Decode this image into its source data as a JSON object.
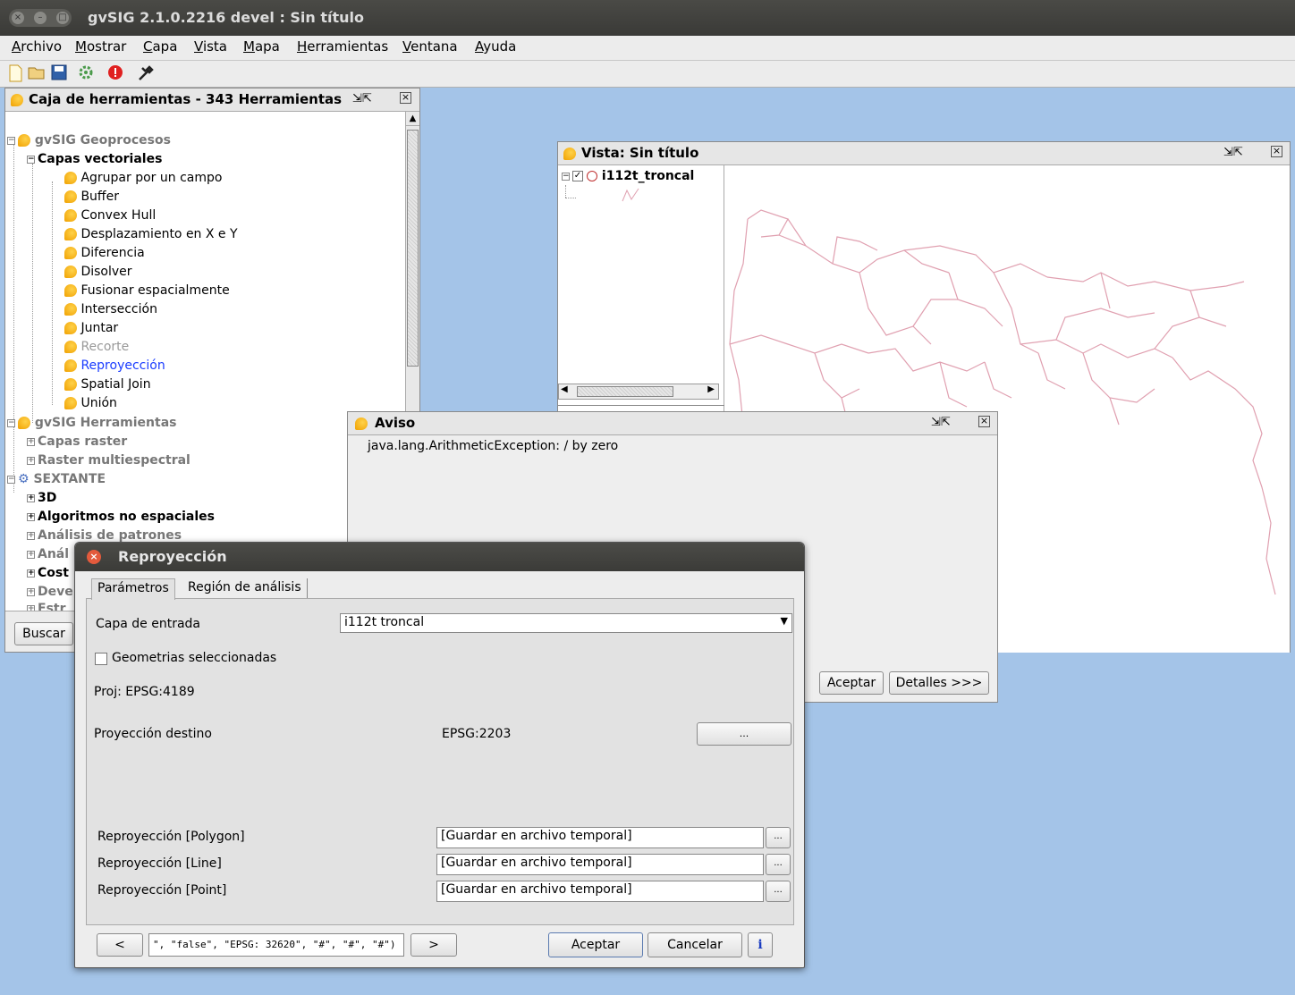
{
  "window": {
    "title": "gvSIG 2.1.0.2216 devel : Sin título",
    "controls": [
      "×",
      "–",
      "□"
    ]
  },
  "menu": {
    "items": [
      "Archivo",
      "Mostrar",
      "Capa",
      "Vista",
      "Mapa",
      "Herramientas",
      "Ventana",
      "Ayuda"
    ]
  },
  "toolbar": {
    "icons": [
      "new-document-icon",
      "open-folder-icon",
      "save-icon",
      "gear-icon",
      "error-icon",
      "tools-icon"
    ]
  },
  "toolbox": {
    "title": "Caja de herramientas - 343 Herramientas",
    "search_label": "Buscar",
    "groups": [
      {
        "label": "gvSIG Geoprocesos"
      },
      {
        "label": "gvSIG Herramientas"
      },
      {
        "label": "SEXTANTE"
      }
    ],
    "vector": {
      "label": "Capas vectoriales",
      "items": [
        "Agrupar por un campo",
        "Buffer",
        "Convex Hull",
        "Desplazamiento en X e Y",
        "Diferencia",
        "Disolver",
        "Fusionar espacialmente",
        "Intersección",
        "Juntar",
        "Recorte",
        "Reproyección",
        "Spatial Join",
        "Unión"
      ]
    },
    "herramientas_children": [
      "Capas raster",
      "Raster multiespectral"
    ],
    "sextante_children": [
      "3D",
      "Algoritmos no espaciales",
      "Análisis de patrones",
      "Anál",
      "Cost",
      "Deve",
      "Estr"
    ]
  },
  "view": {
    "title": "Vista: Sin título",
    "layer_name": "i112t_troncal",
    "line_color": "#e0a0b0"
  },
  "aviso": {
    "title": "Aviso",
    "message": "java.lang.ArithmeticException: / by zero",
    "accept": "Aceptar",
    "details": "Detalles >>>"
  },
  "dialog": {
    "title": "Reproyección",
    "tabs": [
      "Parámetros",
      "Región de análisis"
    ],
    "capa_label": "Capa de entrada",
    "capa_value": "i112t troncal",
    "geom_label": "Geometrias seleccionadas",
    "proj_label": "Proj: EPSG:4189",
    "dest_label": "Proyección destino",
    "dest_value": "EPSG:2203",
    "ellipsis": "...",
    "outputs": [
      {
        "label": "Reproyección [Polygon]",
        "value": "[Guardar en archivo temporal]"
      },
      {
        "label": "Reproyección [Line]",
        "value": "[Guardar en archivo temporal]"
      },
      {
        "label": "Reproyección [Point]",
        "value": "[Guardar en archivo temporal]"
      }
    ],
    "prev": "<",
    "next": ">",
    "command": "\", \"false\", \"EPSG: 32620\", \"#\", \"#\", \"#\")",
    "accept": "Aceptar",
    "cancel": "Cancelar",
    "info": "i"
  }
}
